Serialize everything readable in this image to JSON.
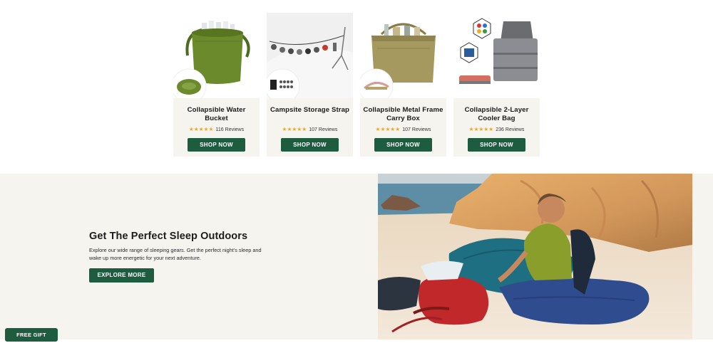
{
  "products": [
    {
      "name": "Collapsible Water Bucket",
      "stars": "★★★★★",
      "reviews": "116 Reviews",
      "cta": "SHOP NOW"
    },
    {
      "name": "Campsite Storage Strap",
      "stars": "★★★★★",
      "reviews": "107 Reviews",
      "cta": "SHOP NOW"
    },
    {
      "name": "Collapsible Metal Frame Carry Box",
      "stars": "★★★★★",
      "reviews": "107 Reviews",
      "cta": "SHOP NOW"
    },
    {
      "name": "Collapsible 2-Layer Cooler Bag",
      "stars": "★★★★★",
      "reviews": "236 Reviews",
      "cta": "SHOP NOW"
    }
  ],
  "sleep_section": {
    "title": "Get The Perfect Sleep Outdoors",
    "description": "Explore our wide range of sleeping gears. Get the perfect night's sleep and wake up more energetic for your next adventure.",
    "cta": "EXPLORE MORE"
  },
  "free_gift": {
    "label": "FREE GIFT"
  },
  "colors": {
    "brand_green": "#1e5c40",
    "star": "#f4a51c",
    "section_bg": "#f6f4ef"
  }
}
